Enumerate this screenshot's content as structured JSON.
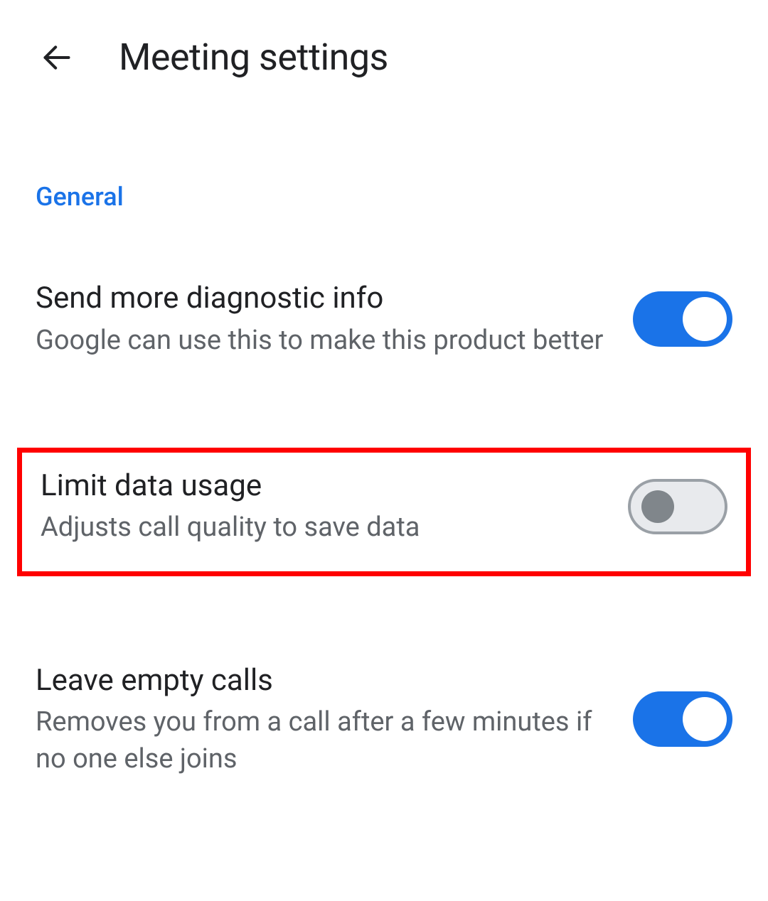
{
  "header": {
    "title": "Meeting settings"
  },
  "section": {
    "label": "General"
  },
  "settings": [
    {
      "title": "Send more diagnostic info",
      "description": "Google can use this to make this product better",
      "enabled": true,
      "highlighted": false
    },
    {
      "title": "Limit data usage",
      "description": "Adjusts call quality to save data",
      "enabled": false,
      "highlighted": true
    },
    {
      "title": "Leave empty calls",
      "description": "Removes you from a call after a few minutes if no one else joins",
      "enabled": true,
      "highlighted": false
    }
  ]
}
